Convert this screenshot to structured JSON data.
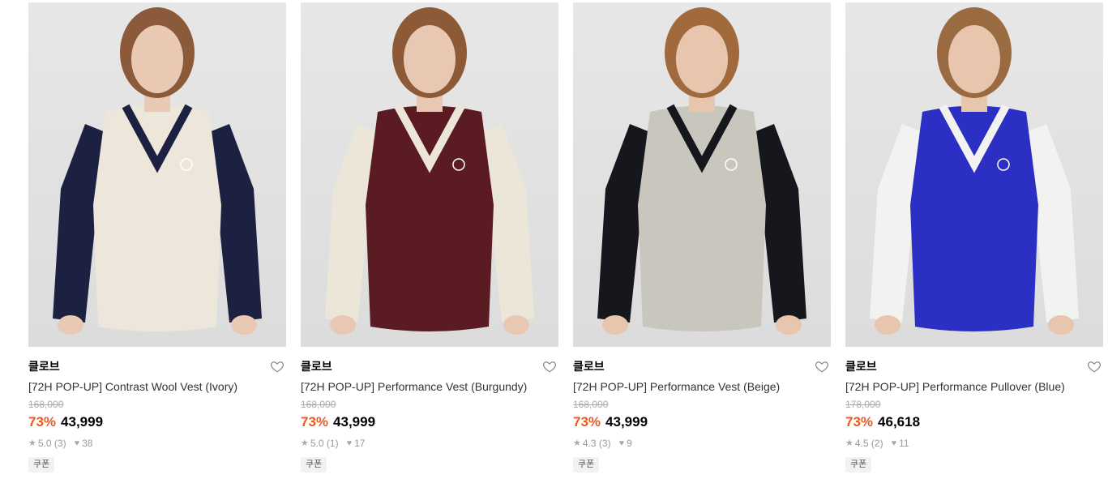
{
  "products": [
    {
      "brand": "클로브",
      "name": "[72H POP-UP] Contrast Wool Vest (Ivory)",
      "original_price": "168,000",
      "discount": "73%",
      "price": "43,999",
      "rating": "5.0",
      "review_count": "(3)",
      "likes": "38",
      "coupon": "쿠폰",
      "garment_color": "#ece7da",
      "undershirt_color": "#1c2142",
      "skin_color": "#e9c9b4",
      "hair_color": "#8a5a3a"
    },
    {
      "brand": "클로브",
      "name": "[72H POP-UP] Performance Vest (Burgundy)",
      "original_price": "168,000",
      "discount": "73%",
      "price": "43,999",
      "rating": "5.0",
      "review_count": "(1)",
      "likes": "17",
      "coupon": "쿠폰",
      "garment_color": "#5a1c22",
      "undershirt_color": "#ece6d8",
      "skin_color": "#e8c8b2",
      "hair_color": "#8d5a38"
    },
    {
      "brand": "클로브",
      "name": "[72H POP-UP] Performance Vest (Beige)",
      "original_price": "168,000",
      "discount": "73%",
      "price": "43,999",
      "rating": "4.3",
      "review_count": "(3)",
      "likes": "9",
      "coupon": "쿠폰",
      "garment_color": "#c9c6be",
      "undershirt_color": "#15171c",
      "skin_color": "#e8c6ad",
      "hair_color": "#a06a3c"
    },
    {
      "brand": "클로브",
      "name": "[72H POP-UP] Performance Pullover (Blue)",
      "original_price": "178,000",
      "discount": "73%",
      "price": "46,618",
      "rating": "4.5",
      "review_count": "(2)",
      "likes": "11",
      "coupon": "쿠폰",
      "garment_color": "#2b2fc4",
      "undershirt_color": "#f2f2f0",
      "skin_color": "#e8c6ad",
      "hair_color": "#9a6a40"
    }
  ],
  "colors": {
    "discount": "#f0581c",
    "strike": "#aaaaaa",
    "meta": "#999999"
  }
}
